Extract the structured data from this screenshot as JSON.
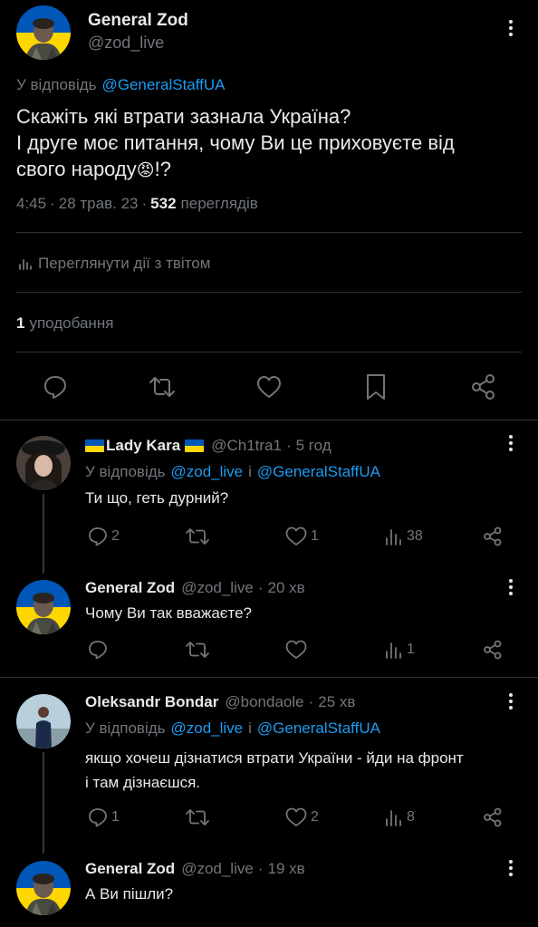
{
  "main_tweet": {
    "author_name": "General Zod",
    "author_handle": "@zod_live",
    "reply_prefix": "У відповідь",
    "reply_to": "@GeneralStaffUA",
    "text_line1": "Скажіть які втрати зазнала Україна?",
    "text_line2": "І друге моє питання, чому Ви це приховуєте від",
    "text_line3": "свого народу",
    "text_emoji": "😡",
    "text_end": "!?",
    "time": "4:45",
    "date": "28 трав. 23",
    "views_count": "532",
    "views_label": "переглядів",
    "activity_label": "Переглянути дії з твітом",
    "likes_count": "1",
    "likes_label": "уподобання"
  },
  "replies": [
    {
      "author_name": "Lady Kara",
      "author_handle": "@Ch1tra1",
      "age": "5 год",
      "reply_prefix": "У відповідь",
      "reply_to_1": "@zod_live",
      "reply_and": "і",
      "reply_to_2": "@GeneralStaffUA",
      "text": "Ти що, геть дурний?",
      "replies": "2",
      "retweets": "",
      "likes": "1",
      "views": "38"
    },
    {
      "author_name": "General Zod",
      "author_handle": "@zod_live",
      "age": "20 хв",
      "text": "Чому Ви так вважаєте?",
      "replies": "",
      "retweets": "",
      "likes": "",
      "views": "1"
    },
    {
      "author_name": "Oleksandr Bondar",
      "author_handle": "@bondaole",
      "age": "25 хв",
      "reply_prefix": "У відповідь",
      "reply_to_1": "@zod_live",
      "reply_and": "і",
      "reply_to_2": "@GeneralStaffUA",
      "text_line1": "якщо хочеш дізнатися втрати України - йди на фронт",
      "text_line2": "і там дізнаєшся.",
      "replies": "1",
      "retweets": "",
      "likes": "2",
      "views": "8"
    },
    {
      "author_name": "General Zod",
      "author_handle": "@zod_live",
      "age": "19 хв",
      "text": "А Ви пішли?"
    }
  ],
  "colors": {
    "background": "#000000",
    "text": "#e7e9ea",
    "secondary": "#71767b",
    "link": "#1d9bf0",
    "divider": "#2f3336",
    "flag_blue": "#0057b7",
    "flag_yellow": "#ffd700"
  }
}
